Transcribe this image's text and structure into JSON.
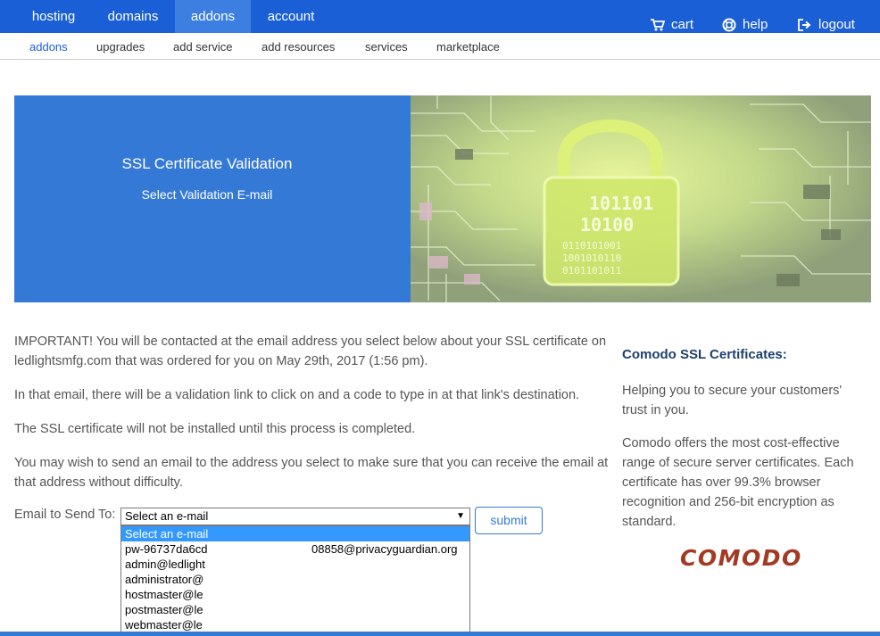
{
  "topnav": {
    "tabs": [
      "hosting",
      "domains",
      "addons",
      "account"
    ],
    "cart": "cart",
    "help": "help",
    "logout": "logout"
  },
  "subnav": {
    "items": [
      "addons",
      "upgrades",
      "add service",
      "add resources",
      "services",
      "marketplace"
    ]
  },
  "hero": {
    "title": "SSL Certificate Validation",
    "subtitle": "Select Validation E-mail"
  },
  "main": {
    "p1": "IMPORTANT! You will be contacted at the email address you select below about your SSL certificate on ledlightsmfg.com that was ordered for you on May 29th, 2017 (1:56 pm).",
    "p2": "In that email, there will be a validation link to click on and a code to type in at that link's destination.",
    "p3": "The SSL certificate will not be installed until this process is completed.",
    "p4": "You may wish to send an email to the address you select to make sure that you can receive the email at that address without difficulty.",
    "email_label": "Email to Send To:",
    "select_value": "Select an e-mail",
    "options": [
      {
        "left": "Select an e-mail",
        "right": ""
      },
      {
        "left": "pw-96737da6cd",
        "right": "08858@privacyguardian.org"
      },
      {
        "left": "admin@ledlight",
        "right": ""
      },
      {
        "left": "administrator@",
        "right": ""
      },
      {
        "left": "hostmaster@le",
        "right": ""
      },
      {
        "left": "postmaster@le",
        "right": ""
      },
      {
        "left": "webmaster@le",
        "right": ""
      }
    ],
    "submit": "submit"
  },
  "sidebar": {
    "title": "Comodo SSL Certificates:",
    "p1": "Helping you to secure your customers' trust in you.",
    "p2": "Comodo offers the most cost-effective range of secure server certificates. Each certificate has over 99.3% browser recognition and 256-bit encryption as standard.",
    "logo_text": "COMODO"
  },
  "colors": {
    "nav_blue": "#1a5fd6",
    "hero_blue": "#3579d6",
    "comodo_red": "#a33a23"
  }
}
